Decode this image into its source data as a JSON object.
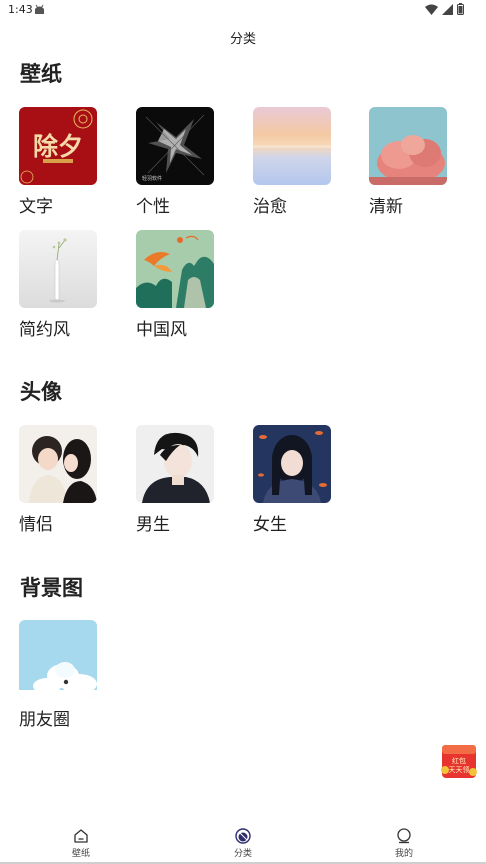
{
  "status_bar": {
    "time": "1:43",
    "icons": [
      "android-debug-icon",
      "wifi-icon",
      "signal-icon",
      "battery-icon"
    ]
  },
  "header": {
    "title": "分类"
  },
  "sections": [
    {
      "title": "壁纸",
      "items": [
        {
          "label": "文字",
          "thumb_text": "除夕"
        },
        {
          "label": "个性",
          "thumb_text": "轻羽软件"
        },
        {
          "label": "治愈"
        },
        {
          "label": "清新"
        },
        {
          "label": "简约风"
        },
        {
          "label": "中国风"
        }
      ]
    },
    {
      "title": "头像",
      "items": [
        {
          "label": "情侣"
        },
        {
          "label": "男生"
        },
        {
          "label": "女生"
        }
      ]
    },
    {
      "title": "背景图",
      "items": [
        {
          "label": "朋友圈"
        }
      ]
    }
  ],
  "floating_ad": {
    "text_1": "红包",
    "text_2": "天天领"
  },
  "bottom_nav": {
    "items": [
      {
        "label": "壁纸",
        "icon": "home-icon",
        "active": false
      },
      {
        "label": "分类",
        "icon": "category-icon",
        "active": true
      },
      {
        "label": "我的",
        "icon": "profile-icon",
        "active": false
      }
    ]
  },
  "colors": {
    "active_nav": "#2d2d6e",
    "ad_red": "#e8342e",
    "section_title": "#222222"
  }
}
